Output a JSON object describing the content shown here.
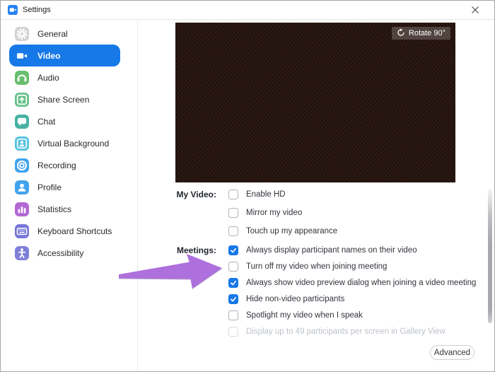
{
  "window": {
    "title": "Settings"
  },
  "colors": {
    "accent": "#1778e8",
    "app_icon_blue": "#2681f2",
    "arrow": "#ae70dd",
    "preview_bg": "#1d110e"
  },
  "sidebar": {
    "items": [
      {
        "label": "General",
        "icon": "gear-icon",
        "color": "#d2d2d6",
        "selected": false
      },
      {
        "label": "Video",
        "icon": "video-camera-icon",
        "color": "",
        "selected": true
      },
      {
        "label": "Audio",
        "icon": "headphones-icon",
        "color": "#67bf6e",
        "selected": false
      },
      {
        "label": "Share Screen",
        "icon": "share-screen-icon",
        "color": "#66c189",
        "selected": false
      },
      {
        "label": "Chat",
        "icon": "chat-bubble-icon",
        "color": "#47b2a2",
        "selected": false
      },
      {
        "label": "Virtual Background",
        "icon": "person-frame-icon",
        "color": "#55c3e2",
        "selected": false
      },
      {
        "label": "Recording",
        "icon": "record-icon",
        "color": "#42a4ee",
        "selected": false
      },
      {
        "label": "Profile",
        "icon": "profile-icon",
        "color": "#42a4ee",
        "selected": false
      },
      {
        "label": "Statistics",
        "icon": "bar-chart-icon",
        "color": "#b468d4",
        "selected": false
      },
      {
        "label": "Keyboard Shortcuts",
        "icon": "keyboard-icon",
        "color": "#7678d8",
        "selected": false
      },
      {
        "label": "Accessibility",
        "icon": "accessibility-icon",
        "color": "#7f7fd9",
        "selected": false
      }
    ]
  },
  "preview": {
    "rotate_label": "Rotate 90°",
    "rotate_icon": "rotate-ccw-icon"
  },
  "sections": [
    {
      "label": "My Video:",
      "items": [
        {
          "label": "Enable HD",
          "checked": false,
          "disabled": false
        },
        {
          "label": "Mirror my video",
          "checked": false,
          "disabled": false
        },
        {
          "label": "Touch up my appearance",
          "checked": false,
          "disabled": false
        }
      ]
    },
    {
      "label": "Meetings:",
      "items": [
        {
          "label": "Always display participant names on their video",
          "checked": true,
          "disabled": false
        },
        {
          "label": "Turn off my video when joining meeting",
          "checked": false,
          "disabled": false
        },
        {
          "label": "Always show video preview dialog when joining a video meeting",
          "checked": true,
          "disabled": false
        },
        {
          "label": "Hide non-video participants",
          "checked": true,
          "disabled": false
        },
        {
          "label": "Spotlight my video when I speak",
          "checked": false,
          "disabled": false
        },
        {
          "label": "Display up to 49 participants per screen in Gallery View",
          "checked": false,
          "disabled": true
        }
      ]
    }
  ],
  "footer": {
    "advanced_label": "Advanced"
  }
}
